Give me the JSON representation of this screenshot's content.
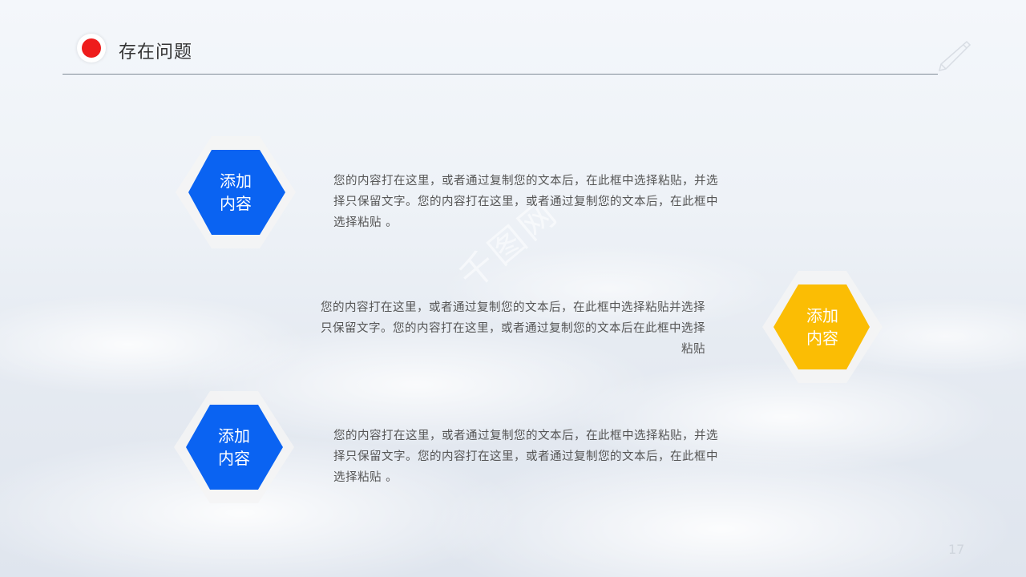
{
  "header": {
    "title": "存在问题"
  },
  "colors": {
    "accent_red": "#ee1c1c",
    "hex_blue": "#0a63f2",
    "hex_yellow": "#fbbd04"
  },
  "items": [
    {
      "hex_label": "添加\n内容",
      "color": "#0a63f2",
      "text": "您的内容打在这里，或者通过复制您的文本后，在此框中选择粘贴，并选择只保留文字。您的内容打在这里，或者通过复制您的文本后，在此框中选择粘贴 。"
    },
    {
      "hex_label": "添加\n内容",
      "color": "#fbbd04",
      "text": "您的内容打在这里，或者通过复制您的文本后，在此框中选择粘贴并选择只保留文字。您的内容打在这里，或者通过复制您的文本后在此框中选择粘贴"
    },
    {
      "hex_label": "添加\n内容",
      "color": "#0a63f2",
      "text": "您的内容打在这里，或者通过复制您的文本后，在此框中选择粘贴，并选择只保留文字。您的内容打在这里，或者通过复制您的文本后，在此框中选择粘贴 。"
    }
  ],
  "page_number": "17",
  "icons": {
    "pen": "pen-icon",
    "dot": "red-dot-icon"
  }
}
